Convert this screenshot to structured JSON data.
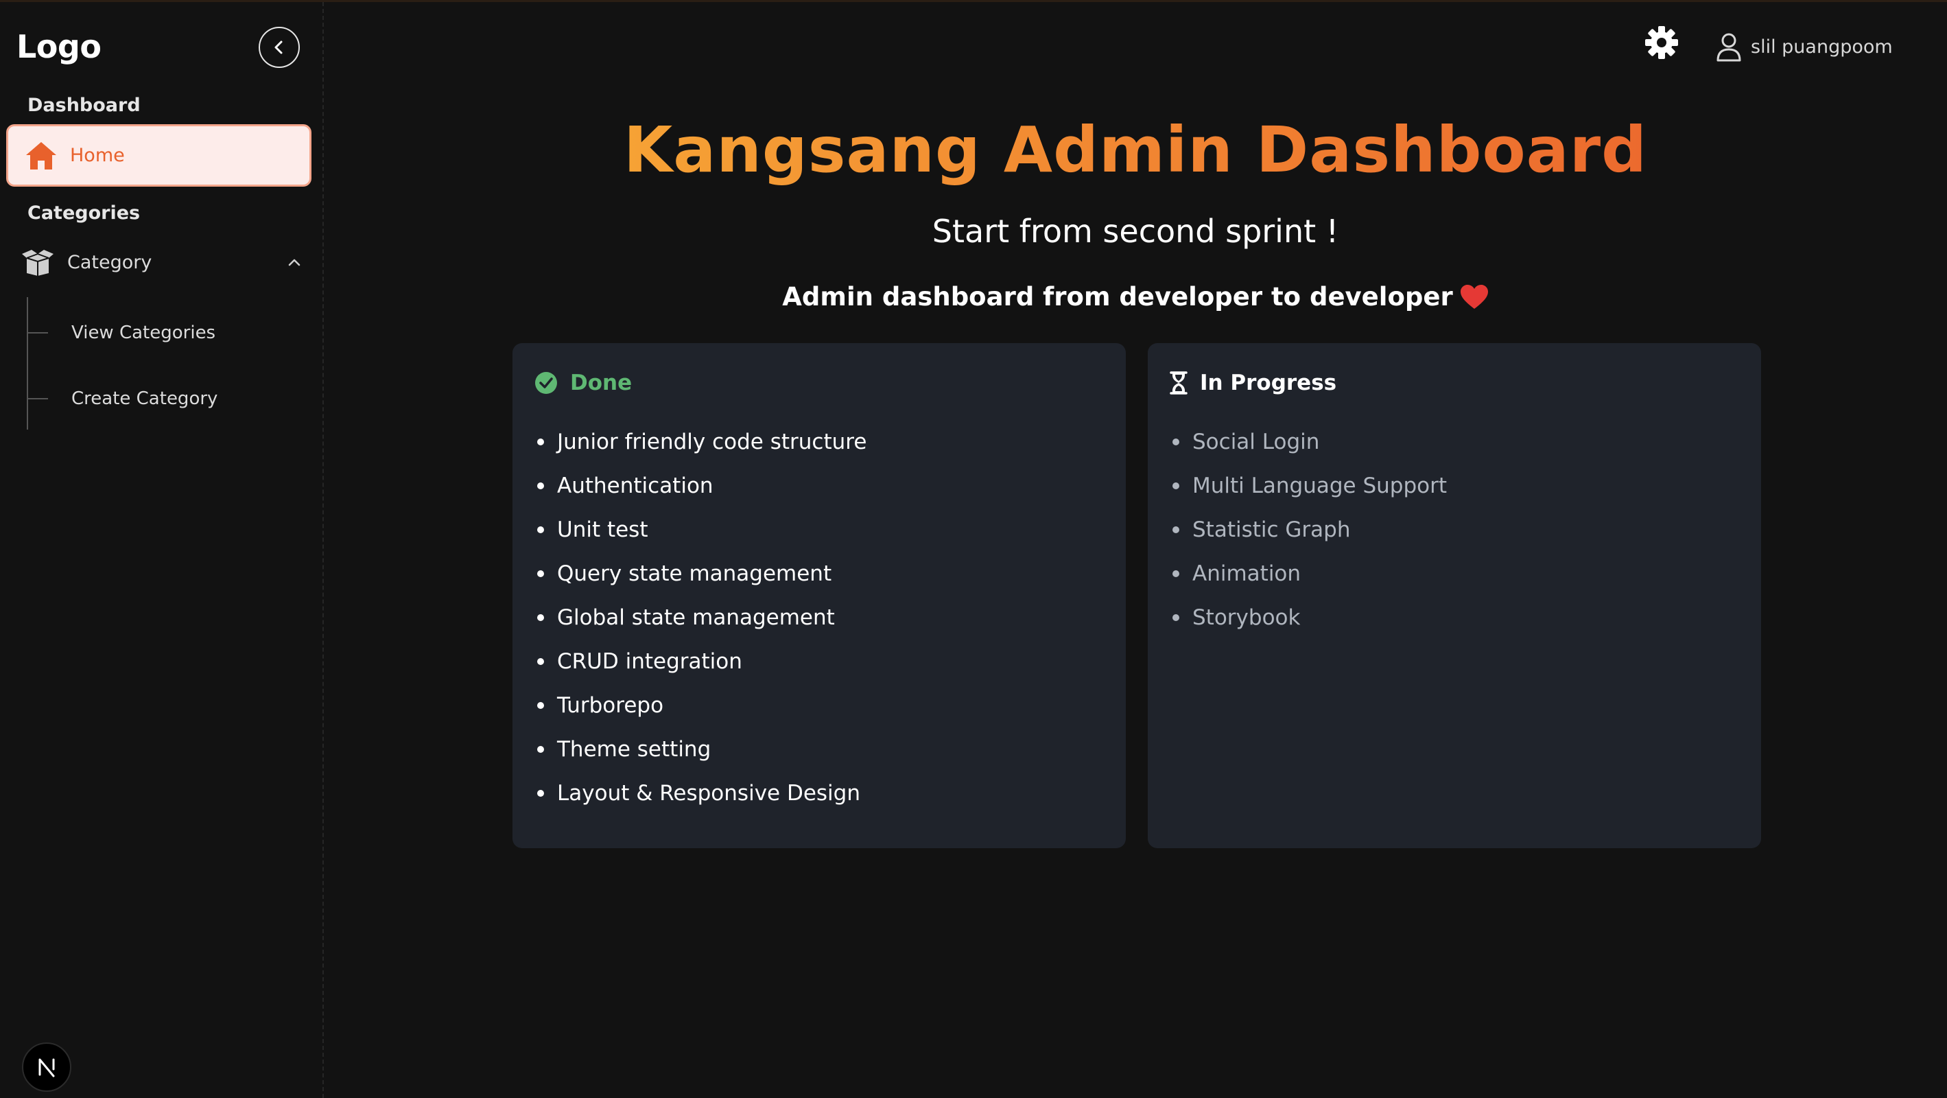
{
  "sidebar": {
    "logo": "Logo",
    "sections": {
      "dashboard": "Dashboard",
      "categories": "Categories"
    },
    "home_label": "Home",
    "category_label": "Category",
    "sub_items": [
      "View Categories",
      "Create Category"
    ]
  },
  "header": {
    "user_name": "slil puangpoom"
  },
  "main": {
    "title": "Kangsang Admin Dashboard",
    "subtitle": "Start from second sprint !",
    "tagline": "Admin dashboard from developer to developer",
    "done": {
      "title": "Done",
      "items": [
        "Junior friendly code structure",
        "Authentication",
        "Unit test",
        "Query state management",
        "Global state management",
        "CRUD integration",
        "Turborepo",
        "Theme setting",
        "Layout & Responsive Design"
      ]
    },
    "in_progress": {
      "title": "In Progress",
      "items": [
        "Social Login",
        "Multi Language Support",
        "Statistic Graph",
        "Animation",
        "Storybook"
      ]
    }
  },
  "colors": {
    "accent": "#e8612c",
    "title_gradient_start": "#f6a235",
    "title_gradient_end": "#ec6a2e",
    "done_green": "#5fb873",
    "heart": "#e53935",
    "card_bg": "#1f232b",
    "page_bg": "#121212"
  },
  "icons": {
    "collapse": "chevron-left-icon",
    "home": "home-icon",
    "category": "box-icon",
    "expand": "chevron-up-icon",
    "theme": "gear-icon",
    "user": "user-icon",
    "done": "check-circle-icon",
    "in_progress": "hourglass-icon",
    "tagline": "heart-icon",
    "framework": "nextjs-icon"
  }
}
